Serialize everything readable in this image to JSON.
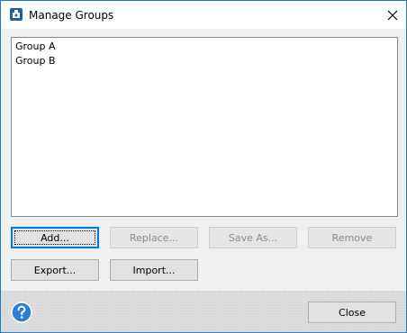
{
  "window": {
    "title": "Manage Groups",
    "accent_color": "#1e78c8"
  },
  "list": {
    "items": [
      "Group A",
      "Group B"
    ]
  },
  "buttons": {
    "add": "Add...",
    "replace": "Replace...",
    "save_as": "Save As...",
    "remove": "Remove",
    "export": "Export...",
    "import": "Import...",
    "close": "Close"
  },
  "icons": {
    "app": "app-icon",
    "close": "close-icon",
    "help": "help-icon"
  }
}
